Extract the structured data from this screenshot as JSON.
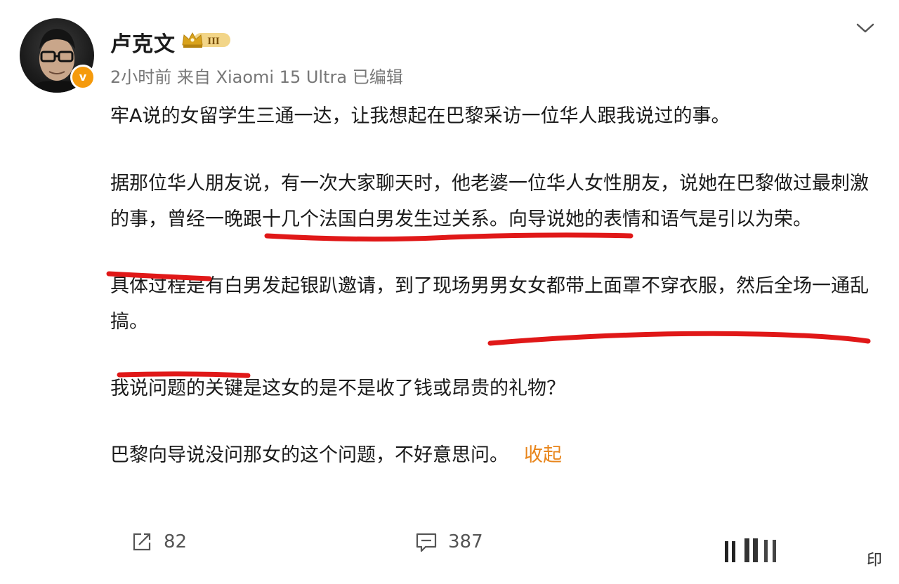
{
  "post": {
    "author": "卢克文",
    "vip_level": "III",
    "verified_mark": "v",
    "meta": "2小时前 来自 Xiaomi 15 Ultra 已编辑",
    "paragraphs": {
      "p1": "牢A说的女留学生三通一达，让我想起在巴黎采访一位华人跟我说过的事。",
      "p2": "据那位华人朋友说，有一次大家聊天时，他老婆一位华人女性朋友，说她在巴黎做过最刺激的事，曾经一晚跟十几个法国白男发生过关系。向导说她的表情和语气是引以为荣。",
      "p3": "具体过程是有白男发起银趴邀请，到了现场男男女女都带上面罩不穿衣服，然后全场一通乱搞。",
      "p4": "我说问题的关键是这女的是不是收了钱或昂贵的礼物？",
      "p5": "巴黎向导说没问那女的这个问题，不好意思问。"
    },
    "fold_label": "收起"
  },
  "actions": {
    "repost_count": "82",
    "comment_count": "387"
  },
  "watermark": "印",
  "colors": {
    "underline": "#e01818",
    "fold_link": "#e8851b",
    "vip_gold": "#d9a21b",
    "verified_orange": "#f59a0c"
  }
}
